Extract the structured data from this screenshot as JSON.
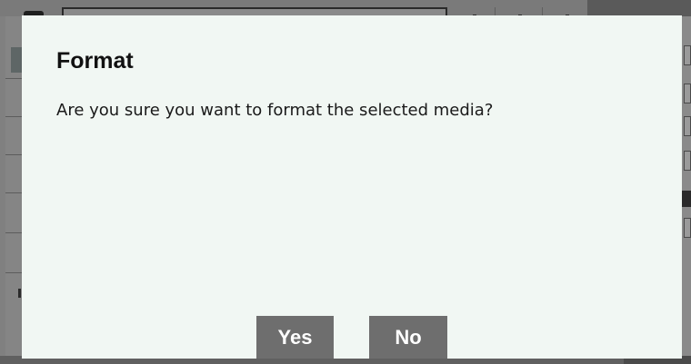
{
  "dialog": {
    "title": "Format",
    "message": "Are you sure you want to format the selected media?",
    "buttons": {
      "yes_label": "Yes",
      "no_label": "No"
    }
  },
  "colors": {
    "dialog_background": "#f1f7f3",
    "button_background": "#6e6e6e",
    "button_text": "#ffffff",
    "overlay": "#808080"
  }
}
